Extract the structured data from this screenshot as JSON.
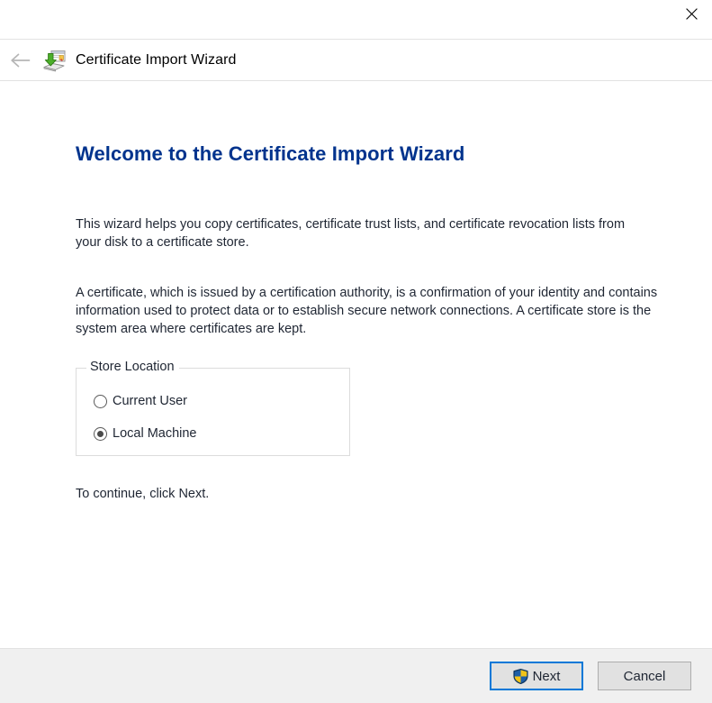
{
  "window": {
    "title": "Certificate Import Wizard",
    "close_label": "Close",
    "close_icon": "close-icon",
    "back_icon": "back-arrow-icon",
    "app_icon": "certificate-import-icon"
  },
  "page": {
    "heading": "Welcome to the Certificate Import Wizard",
    "paragraph_1": "This wizard helps you copy certificates, certificate trust lists, and certificate revocation lists from your disk to a certificate store.",
    "paragraph_2": "A certificate, which is issued by a certification authority, is a confirmation of your identity and contains information used to protect data or to establish secure network connections. A certificate store is the system area where certificates are kept.",
    "continue_text": "To continue, click Next."
  },
  "store_location": {
    "legend": "Store Location",
    "selected": "local_machine",
    "options": [
      {
        "id": "current_user",
        "label": "Current User",
        "checked": false
      },
      {
        "id": "local_machine",
        "label": "Local Machine",
        "checked": true
      }
    ]
  },
  "footer": {
    "next_label": "Next",
    "next_icon": "uac-shield-icon",
    "cancel_label": "Cancel"
  },
  "colors": {
    "heading": "#00338d",
    "body_text": "#1f2633",
    "footer_background": "#f0f0f0",
    "focus_border": "#0078d7",
    "button_face": "#e1e1e1",
    "button_border": "#adadad",
    "group_border": "#dcdcdc",
    "shield_blue": "#1e5fa8",
    "shield_yellow": "#f2c318"
  }
}
